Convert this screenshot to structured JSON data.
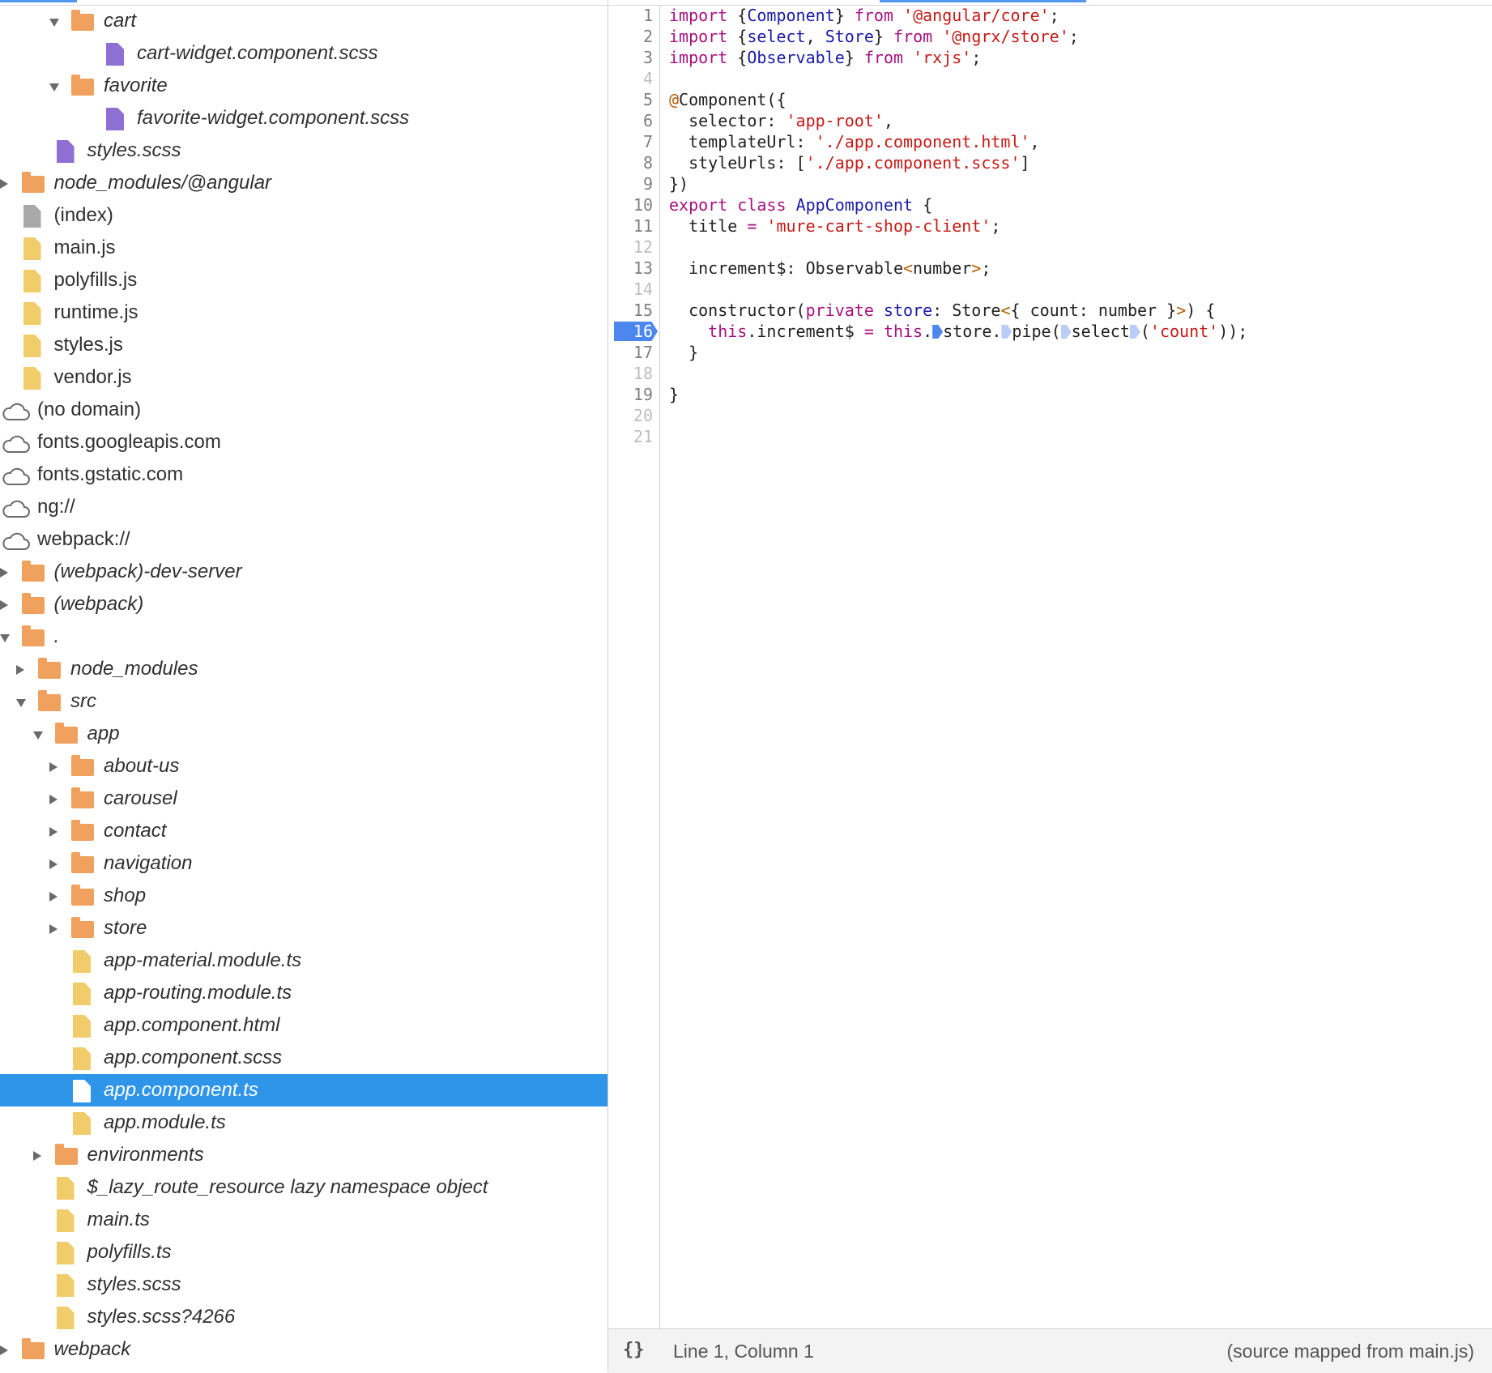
{
  "file_tree": {
    "rows": [
      {
        "label": "cart",
        "icon": "folder-icon",
        "indent": 6,
        "toggle": "open",
        "italic": true
      },
      {
        "label": "cart-widget.component.scss",
        "icon": "css-file-icon",
        "indent": 8,
        "italic": true
      },
      {
        "label": "favorite",
        "icon": "folder-icon",
        "indent": 6,
        "toggle": "open",
        "italic": true
      },
      {
        "label": "favorite-widget.component.scss",
        "icon": "css-file-icon",
        "indent": 8,
        "italic": true
      },
      {
        "label": "styles.scss",
        "icon": "css-file-icon",
        "indent": 5,
        "italic": true
      },
      {
        "label": "node_modules/@angular",
        "icon": "folder-icon",
        "indent": 3,
        "toggle": "closed",
        "italic": true
      },
      {
        "label": "(index)",
        "icon": "document-file-icon",
        "indent": 3
      },
      {
        "label": "main.js",
        "icon": "script-file-icon",
        "indent": 3
      },
      {
        "label": "polyfills.js",
        "icon": "script-file-icon",
        "indent": 3
      },
      {
        "label": "runtime.js",
        "icon": "script-file-icon",
        "indent": 3
      },
      {
        "label": "styles.js",
        "icon": "script-file-icon",
        "indent": 3
      },
      {
        "label": "vendor.js",
        "icon": "script-file-icon",
        "indent": 3
      },
      {
        "label": "(no domain)",
        "icon": "cloud-icon",
        "indent": 2,
        "toggle": "closed"
      },
      {
        "label": "fonts.googleapis.com",
        "icon": "cloud-icon",
        "indent": 2,
        "toggle": "closed"
      },
      {
        "label": "fonts.gstatic.com",
        "icon": "cloud-icon",
        "indent": 2,
        "toggle": "closed"
      },
      {
        "label": "ng://",
        "icon": "cloud-icon",
        "indent": 2,
        "toggle": "closed"
      },
      {
        "label": "webpack://",
        "icon": "cloud-icon",
        "indent": 2,
        "toggle": "open"
      },
      {
        "label": "(webpack)-dev-server",
        "icon": "folder-icon",
        "indent": 3,
        "toggle": "closed",
        "italic": true
      },
      {
        "label": "(webpack)",
        "icon": "folder-icon",
        "indent": 3,
        "toggle": "closed",
        "italic": true
      },
      {
        "label": ".",
        "icon": "folder-icon",
        "indent": 3,
        "toggle": "open",
        "italic": true
      },
      {
        "label": "node_modules",
        "icon": "folder-icon",
        "indent": 4,
        "toggle": "closed",
        "italic": true
      },
      {
        "label": "src",
        "icon": "folder-icon",
        "indent": 4,
        "toggle": "open",
        "italic": true
      },
      {
        "label": "app",
        "icon": "folder-icon",
        "indent": 5,
        "toggle": "open",
        "italic": true
      },
      {
        "label": "about-us",
        "icon": "folder-icon",
        "indent": 6,
        "toggle": "closed",
        "italic": true
      },
      {
        "label": "carousel",
        "icon": "folder-icon",
        "indent": 6,
        "toggle": "closed",
        "italic": true
      },
      {
        "label": "contact",
        "icon": "folder-icon",
        "indent": 6,
        "toggle": "closed",
        "italic": true
      },
      {
        "label": "navigation",
        "icon": "folder-icon",
        "indent": 6,
        "toggle": "closed",
        "italic": true
      },
      {
        "label": "shop",
        "icon": "folder-icon",
        "indent": 6,
        "toggle": "closed",
        "italic": true
      },
      {
        "label": "store",
        "icon": "folder-icon",
        "indent": 6,
        "toggle": "closed",
        "italic": true
      },
      {
        "label": "app-material.module.ts",
        "icon": "script-file-icon",
        "indent": 6,
        "italic": true
      },
      {
        "label": "app-routing.module.ts",
        "icon": "script-file-icon",
        "indent": 6,
        "italic": true
      },
      {
        "label": "app.component.html",
        "icon": "script-file-icon",
        "indent": 6,
        "italic": true
      },
      {
        "label": "app.component.scss",
        "icon": "script-file-icon",
        "indent": 6,
        "italic": true
      },
      {
        "label": "app.component.ts",
        "icon": "script-file-icon",
        "indent": 6,
        "italic": true,
        "selected": true
      },
      {
        "label": "app.module.ts",
        "icon": "script-file-icon",
        "indent": 6,
        "italic": true
      },
      {
        "label": "environments",
        "icon": "folder-icon",
        "indent": 5,
        "toggle": "closed",
        "italic": true
      },
      {
        "label": "$_lazy_route_resource lazy namespace object",
        "icon": "script-file-icon",
        "indent": 5,
        "italic": true
      },
      {
        "label": "main.ts",
        "icon": "script-file-icon",
        "indent": 5,
        "italic": true
      },
      {
        "label": "polyfills.ts",
        "icon": "script-file-icon",
        "indent": 5,
        "italic": true
      },
      {
        "label": "styles.scss",
        "icon": "script-file-icon",
        "indent": 5,
        "italic": true
      },
      {
        "label": "styles.scss?4266",
        "icon": "script-file-icon",
        "indent": 5,
        "italic": true
      },
      {
        "label": "webpack",
        "icon": "folder-icon",
        "indent": 3,
        "toggle": "closed",
        "italic": true
      }
    ]
  },
  "editor": {
    "breakpoint_line": 16,
    "lines": [
      [
        {
          "t": "import",
          "c": "kw"
        },
        {
          "t": " {"
        },
        {
          "t": "Component",
          "c": "ty"
        },
        {
          "t": "} "
        },
        {
          "t": "from",
          "c": "kw"
        },
        {
          "t": " "
        },
        {
          "t": "'@angular/core'",
          "c": "str"
        },
        {
          "t": ";"
        }
      ],
      [
        {
          "t": "import",
          "c": "kw"
        },
        {
          "t": " {"
        },
        {
          "t": "select",
          "c": "ty"
        },
        {
          "t": ", "
        },
        {
          "t": "Store",
          "c": "ty"
        },
        {
          "t": "} "
        },
        {
          "t": "from",
          "c": "kw"
        },
        {
          "t": " "
        },
        {
          "t": "'@ngrx/store'",
          "c": "str"
        },
        {
          "t": ";"
        }
      ],
      [
        {
          "t": "import",
          "c": "kw"
        },
        {
          "t": " {"
        },
        {
          "t": "Observable",
          "c": "ty"
        },
        {
          "t": "} "
        },
        {
          "t": "from",
          "c": "kw"
        },
        {
          "t": " "
        },
        {
          "t": "'rxjs'",
          "c": "str"
        },
        {
          "t": ";"
        }
      ],
      [],
      [
        {
          "t": "@",
          "c": "at"
        },
        {
          "t": "Component({"
        }
      ],
      [
        {
          "t": "  selector: "
        },
        {
          "t": "'app-root'",
          "c": "str"
        },
        {
          "t": ","
        }
      ],
      [
        {
          "t": "  templateUrl: "
        },
        {
          "t": "'./app.component.html'",
          "c": "str"
        },
        {
          "t": ","
        }
      ],
      [
        {
          "t": "  styleUrls: ["
        },
        {
          "t": "'./app.component.scss'",
          "c": "str"
        },
        {
          "t": "]"
        }
      ],
      [
        {
          "t": "})"
        }
      ],
      [
        {
          "t": "export",
          "c": "kw"
        },
        {
          "t": " "
        },
        {
          "t": "class",
          "c": "kw"
        },
        {
          "t": " "
        },
        {
          "t": "AppComponent",
          "c": "ty"
        },
        {
          "t": " {"
        }
      ],
      [
        {
          "t": "  title "
        },
        {
          "t": "=",
          "c": "kw"
        },
        {
          "t": " "
        },
        {
          "t": "'mure-cart-shop-client'",
          "c": "str"
        },
        {
          "t": ";"
        }
      ],
      [],
      [
        {
          "t": "  increment$: Observable"
        },
        {
          "t": "<",
          "c": "at"
        },
        {
          "t": "number"
        },
        {
          "t": ">",
          "c": "at"
        },
        {
          "t": ";"
        }
      ],
      [],
      [
        {
          "t": "  constructor("
        },
        {
          "t": "private",
          "c": "kw"
        },
        {
          "t": " "
        },
        {
          "t": "store",
          "c": "ty"
        },
        {
          "t": ": Store"
        },
        {
          "t": "<",
          "c": "at"
        },
        {
          "t": "{ count: number }"
        },
        {
          "t": ">",
          "c": "at"
        },
        {
          "t": ") {"
        }
      ],
      [
        {
          "t": "    "
        },
        {
          "t": "this",
          "c": "kw"
        },
        {
          "t": ".increment$ "
        },
        {
          "t": "=",
          "c": "kw"
        },
        {
          "t": " "
        },
        {
          "t": "this",
          "c": "kw"
        },
        {
          "t": "."
        },
        {
          "m": "dark"
        },
        {
          "t": "store."
        },
        {
          "m": "light"
        },
        {
          "t": "pipe("
        },
        {
          "m": "light"
        },
        {
          "t": "select"
        },
        {
          "m": "light"
        },
        {
          "t": "("
        },
        {
          "t": "'count'",
          "c": "str"
        },
        {
          "t": "));"
        }
      ],
      [
        {
          "t": "  }"
        }
      ],
      [],
      [
        {
          "t": "}"
        }
      ],
      [],
      []
    ]
  },
  "status_bar": {
    "pretty_print_label": "{}",
    "cursor_position": "Line 1, Column 1",
    "source_mapped": "(source mapped from main.js)"
  }
}
